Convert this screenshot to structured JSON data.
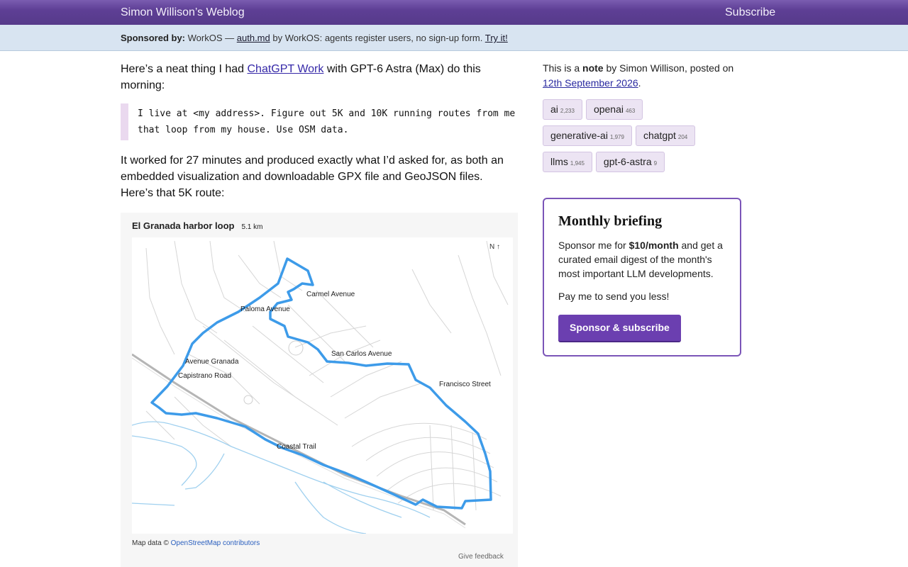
{
  "header": {
    "site_title": "Simon Willison’s Weblog",
    "subscribe_label": "Subscribe"
  },
  "sponsor": {
    "label": "Sponsored by:",
    "company": "WorkOS —",
    "link_text": "auth.md",
    "tagline": "by WorkOS: agents register users, no sign-up form.",
    "cta": "Try it!"
  },
  "post": {
    "intro_before": "Here’s a neat thing I had",
    "intro_link": "ChatGPT Work",
    "intro_after": "with GPT-6 Astra (Max) do this morning:",
    "quote": "I live at <my address>. Figure out 5K and 10K running routes from me that loop from my house. Use OSM data.",
    "para2": "It worked for 27 minutes and produced exactly what I’d asked for, as both an embedded visualization and downloadable GPX file and GeoJSON files. Here’s that 5K route:"
  },
  "map": {
    "title": "El Granada harbor loop",
    "distance": "5.1 km",
    "north": "N ↑",
    "streets": {
      "carmel": "Carmel Avenue",
      "paloma": "Paloma Avenue",
      "san_carlos": "San Carlos Avenue",
      "avenue_granada": "Avenue Granada",
      "capistrano": "Capistrano Road",
      "francisco": "Francisco Street",
      "coastal": "Coastal Trail"
    },
    "attribution_prefix": "Map data ©",
    "attribution_link": "OpenStreetMap contributors",
    "feedback": "Give feedback",
    "route_color": "#3d9be9"
  },
  "sidebar": {
    "meta_prefix": "This is a",
    "meta_note": "note",
    "meta_by": "by Simon Willison, posted on",
    "meta_date": "12th September 2026",
    "meta_end": ".",
    "tags": [
      {
        "name": "ai",
        "count": "2,233"
      },
      {
        "name": "openai",
        "count": "463"
      },
      {
        "name": "generative-ai",
        "count": "1,979"
      },
      {
        "name": "chatgpt",
        "count": "204"
      },
      {
        "name": "llms",
        "count": "1,945"
      },
      {
        "name": "gpt-6-astra",
        "count": "9"
      }
    ]
  },
  "briefing": {
    "title": "Monthly briefing",
    "text_before": "Sponsor me for",
    "price": "$10/month",
    "text_after": "and get a curated email digest of the month's most important LLM developments.",
    "text2": "Pay me to send you less!",
    "button": "Sponsor & subscribe"
  },
  "colors": {
    "header_purple": "#5e3f95",
    "sponsor_bg": "#d8e4f1",
    "tag_bg": "#ece4f3",
    "button_purple": "#6b3fb0"
  }
}
